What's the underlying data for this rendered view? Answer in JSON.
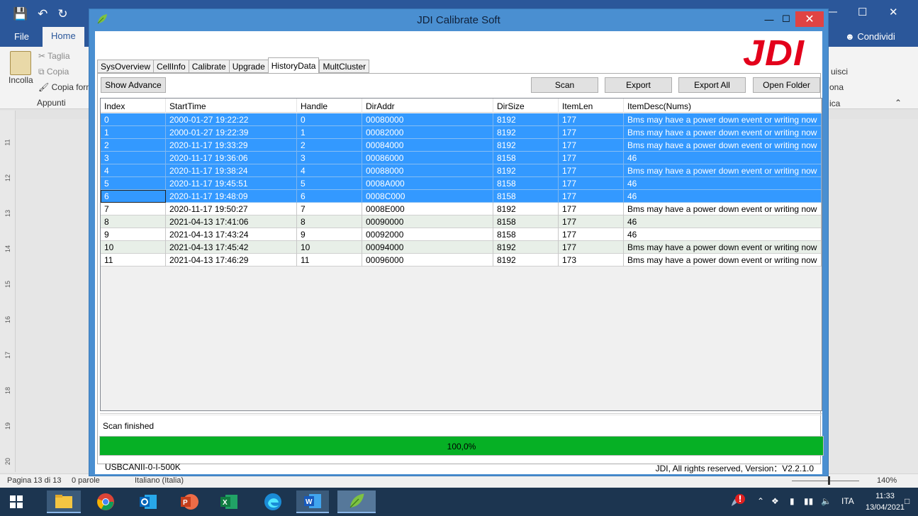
{
  "word": {
    "tabs": {
      "file": "File",
      "home": "Home"
    },
    "share": "Condividi",
    "clipboard": {
      "paste": "Incolla",
      "cut": "Taglia",
      "copy": "Copia",
      "format_painter": "Copia form",
      "group": "Appunti"
    },
    "right_labels": {
      "a": "uisci",
      "b": "ona",
      "c": "ica"
    },
    "ruler_numbers": [
      "11",
      "12",
      "13",
      "14",
      "15",
      "16",
      "17",
      "18",
      "19",
      "20"
    ],
    "status": {
      "page": "Pagina 13 di 13",
      "words": "0 parole",
      "language": "Italiano (Italia)",
      "zoom": "140%"
    }
  },
  "app": {
    "title": "JDI Calibrate Soft",
    "logo": "JDI",
    "tabs": [
      "SysOverview",
      "CellInfo",
      "Calibrate",
      "Upgrade",
      "HistoryData",
      "MultCluster"
    ],
    "active_tab": "HistoryData",
    "buttons": {
      "show_advance": "Show Advance",
      "scan": "Scan",
      "export": "Export",
      "export_all": "Export All",
      "open_folder": "Open Folder"
    },
    "table": {
      "columns": [
        "Index",
        "StartTime",
        "Handle",
        "DirAddr",
        "DirSize",
        "ItemLen",
        "ItemDesc(Nums)"
      ],
      "rows": [
        [
          "0",
          "2000-01-27 19:22:22",
          "0",
          "00080000",
          "8192",
          "177",
          "Bms may have a power down event or writing now"
        ],
        [
          "1",
          "2000-01-27 19:22:39",
          "1",
          "00082000",
          "8192",
          "177",
          "Bms may have a power down event or writing now"
        ],
        [
          "2",
          "2020-11-17 19:33:29",
          "2",
          "00084000",
          "8192",
          "177",
          "Bms may have a power down event or writing now"
        ],
        [
          "3",
          "2020-11-17 19:36:06",
          "3",
          "00086000",
          "8158",
          "177",
          "46"
        ],
        [
          "4",
          "2020-11-17 19:38:24",
          "4",
          "00088000",
          "8192",
          "177",
          "Bms may have a power down event or writing now"
        ],
        [
          "5",
          "2020-11-17 19:45:51",
          "5",
          "0008A000",
          "8158",
          "177",
          "46"
        ],
        [
          "6",
          "2020-11-17 19:48:09",
          "6",
          "0008C000",
          "8158",
          "177",
          "46"
        ],
        [
          "7",
          "2020-11-17 19:50:27",
          "7",
          "0008E000",
          "8192",
          "177",
          "Bms may have a power down event or writing now"
        ],
        [
          "8",
          "2021-04-13 17:41:06",
          "8",
          "00090000",
          "8158",
          "177",
          "46"
        ],
        [
          "9",
          "2021-04-13 17:43:24",
          "9",
          "00092000",
          "8158",
          "177",
          "46"
        ],
        [
          "10",
          "2021-04-13 17:45:42",
          "10",
          "00094000",
          "8192",
          "177",
          "Bms may have a power down event or writing now"
        ],
        [
          "11",
          "2021-04-13 17:46:29",
          "11",
          "00096000",
          "8192",
          "173",
          "Bms may have a power down event or writing now"
        ]
      ],
      "selected_rows": [
        0,
        1,
        2,
        3,
        4,
        5,
        6
      ]
    },
    "status_text": "Scan finished",
    "progress": {
      "value": 1.0,
      "label": "100,0%"
    },
    "footer": {
      "device": "USBCANII-0-I-500K",
      "copyright": "JDI,  All rights reserved, Version：V2.2.1.0"
    }
  },
  "taskbar": {
    "language": "ITA",
    "time": "11:33",
    "date": "13/04/2021"
  },
  "colors": {
    "selection": "#3399ff",
    "progress": "#06b025",
    "logo": "#e3001b",
    "titlebar": "#4a8fd1"
  }
}
